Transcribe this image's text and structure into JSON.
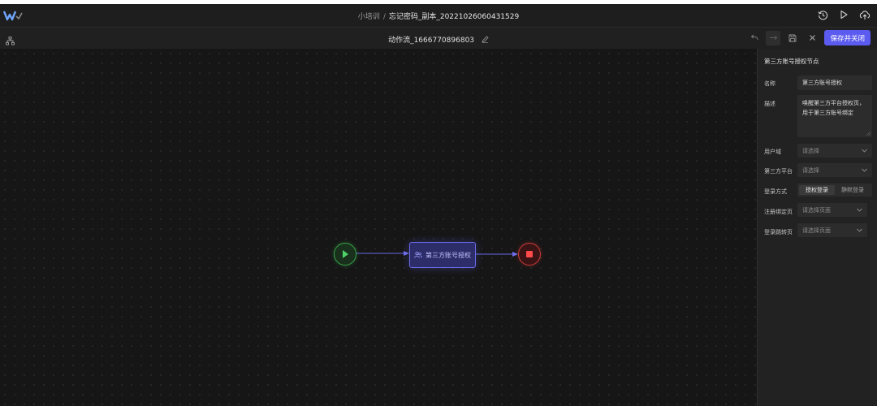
{
  "topbar": {
    "breadcrumb_parent": "小培训",
    "breadcrumb_separator": "/",
    "breadcrumb_current": "忘记密码_副本_20221026060431529",
    "icons": [
      "logo-icon",
      "history-icon",
      "play-icon",
      "cloud-upload-icon"
    ]
  },
  "subbar": {
    "flow_name": "动作流_1666770896803",
    "save_close_label": "保存并关闭",
    "icons": [
      "sitemap-icon",
      "edit-icon",
      "undo-icon",
      "redo-icon",
      "save-icon",
      "close-icon"
    ]
  },
  "canvas": {
    "task_node_label": "第三方账号授权",
    "nodes": [
      "start",
      "task",
      "end"
    ],
    "colors": {
      "start": "#38a048",
      "end": "#c83a3a",
      "task": "#6a6ae8",
      "edge": "#6a6ae8"
    }
  },
  "panel": {
    "title": "第三方账号授权节点",
    "name_label": "名称",
    "name_value": "第三方账号授权",
    "desc_label": "描述",
    "desc_line1": "唤醒第三方平台授权页，",
    "desc_line2": "用于第三方账号绑定",
    "user_domain_label": "用户域",
    "user_domain_placeholder": "请选择",
    "platform_label": "第三方平台",
    "platform_placeholder": "请选择",
    "login_mode_label": "登录方式",
    "login_mode_options": [
      "授权登录",
      "静默登录"
    ],
    "login_mode_selected": "授权登录",
    "bind_page_label": "注册绑定页",
    "bind_page_placeholder": "请选择页面",
    "redirect_page_label": "登录跳转页",
    "redirect_page_placeholder": "请选择页面"
  },
  "accent_color": "#5b5bf0"
}
